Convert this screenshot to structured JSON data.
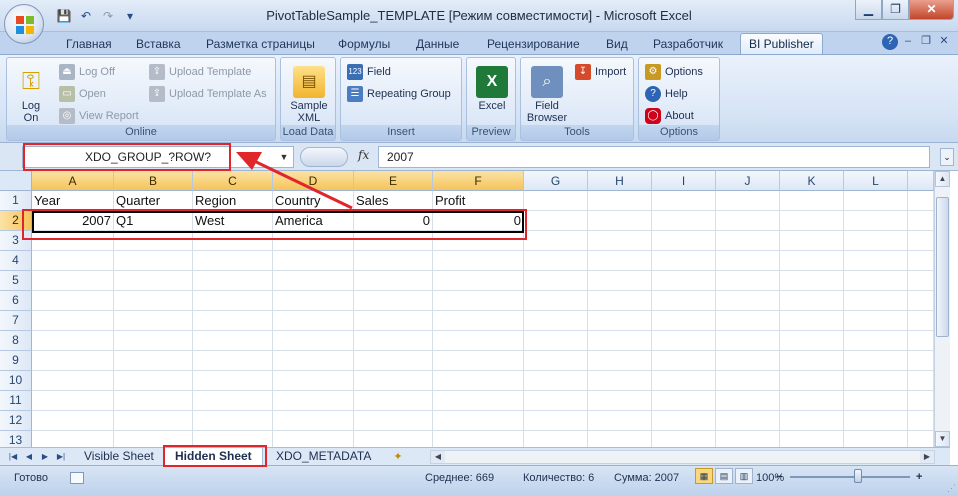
{
  "window": {
    "title": "PivotTableSample_TEMPLATE  [Режим совместимости] - Microsoft Excel",
    "min": "▁",
    "max": "❐",
    "close": "✕"
  },
  "qat": {
    "save": "💾",
    "undo": "↶",
    "redo": "↷",
    "customize": "▾"
  },
  "tabs": [
    "Главная",
    "Вставка",
    "Разметка страницы",
    "Формулы",
    "Данные",
    "Рецензирование",
    "Вид",
    "Разработчик",
    "BI Publisher"
  ],
  "help": "?",
  "ribbon": {
    "online": {
      "label": "Online",
      "login": "Log\nOn",
      "logoff": "Log Off",
      "open": "Open",
      "viewreport": "View Report",
      "upload": "Upload Template",
      "uploadas": "Upload Template As"
    },
    "loaddata": {
      "label": "Load Data",
      "sample": "Sample\nXML"
    },
    "insert": {
      "label": "Insert",
      "field": "Field",
      "repeating": "Repeating Group"
    },
    "preview": {
      "label": "Preview",
      "excel": "Excel"
    },
    "tools": {
      "label": "Tools",
      "browser": "Field\nBrowser",
      "import": "Import"
    },
    "options": {
      "label": "Options",
      "options": "Options",
      "help": "Help",
      "about": "About"
    }
  },
  "formula": {
    "namebox": "XDO_GROUP_?ROW?",
    "fx": "fx",
    "value": "2007"
  },
  "columns": [
    "A",
    "B",
    "C",
    "D",
    "E",
    "F",
    "G",
    "H",
    "I",
    "J",
    "K",
    "L"
  ],
  "rows": [
    "1",
    "2",
    "3",
    "4",
    "5",
    "6",
    "7",
    "8",
    "9",
    "10",
    "11",
    "12",
    "13"
  ],
  "cells": {
    "r1": [
      "Year",
      "Quarter",
      "Region",
      "Country",
      "Sales",
      "Profit"
    ],
    "r2": [
      "2007",
      "Q1",
      "West",
      "America",
      "0",
      "0"
    ]
  },
  "sheets": [
    "Visible Sheet",
    "Hidden Sheet",
    "XDO_METADATA"
  ],
  "status": {
    "ready": "Готово",
    "average": "Среднее: 669",
    "count": "Количество: 6",
    "sum": "Сумма: 2007",
    "zoom": "100%",
    "minus": "−",
    "plus": "+"
  },
  "colors": {
    "accent": "#e0262a",
    "selection": "#f6c35b"
  }
}
